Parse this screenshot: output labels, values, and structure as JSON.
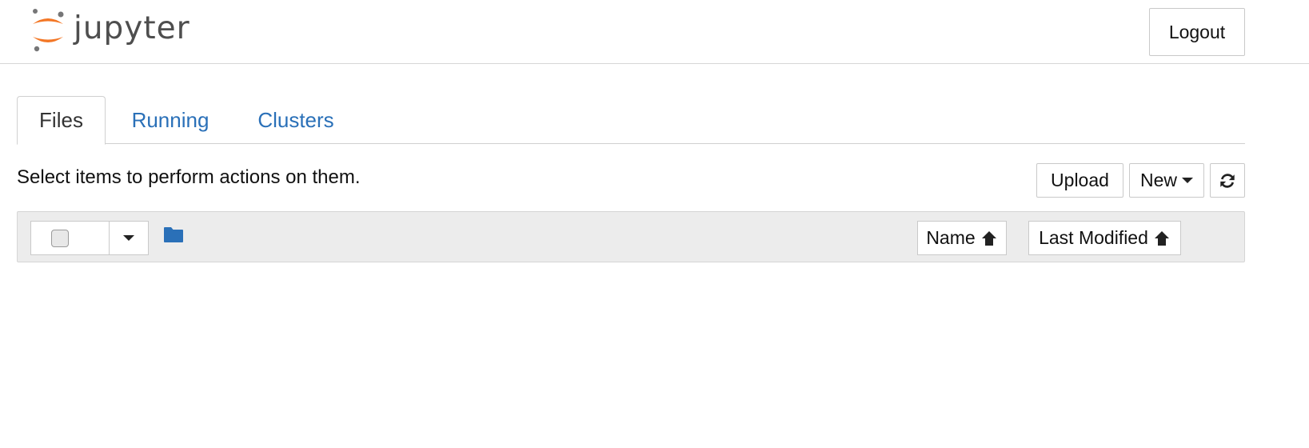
{
  "header": {
    "logo_text": "jupyter",
    "logout_label": "Logout"
  },
  "tabs": [
    {
      "label": "Files",
      "active": true
    },
    {
      "label": "Running",
      "active": false
    },
    {
      "label": "Clusters",
      "active": false
    }
  ],
  "instructions": "Select items to perform actions on them.",
  "actions": {
    "upload_label": "Upload",
    "new_label": "New",
    "refresh_icon": "refresh-icon"
  },
  "list_toolbar": {
    "select_all_checked": false,
    "folder_icon": "folder-icon",
    "sort_name_label": "Name",
    "sort_modified_label": "Last Modified"
  },
  "colors": {
    "link": "#2a70b8",
    "logo_orange": "#f37726",
    "toolbar_bg": "#ececec"
  }
}
